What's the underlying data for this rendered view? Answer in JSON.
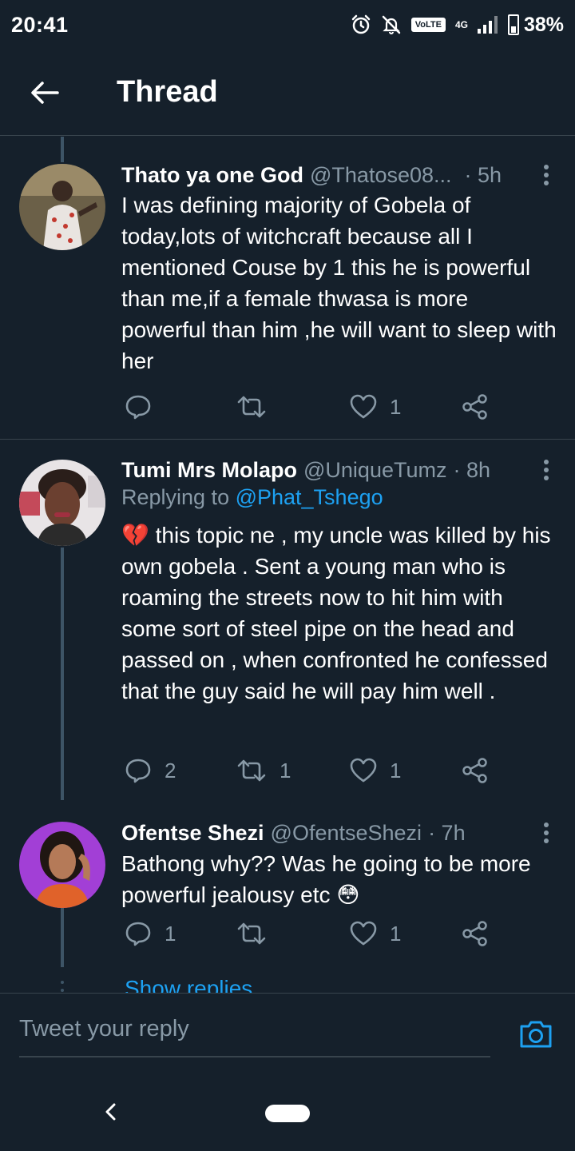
{
  "status_bar": {
    "time": "20:41",
    "volte": "VoLTE",
    "network": "4G",
    "battery": "38%"
  },
  "header": {
    "title": "Thread"
  },
  "tweets": [
    {
      "name": "Thato ya one God",
      "handle": "@Thatose08...",
      "time": "· 5h",
      "text": "I was defining majority of Gobela of today,lots of witchcraft because all I mentioned Couse by 1 this he is powerful than me,if a female thwasa is more powerful than him ,he will want to sleep with her",
      "replies": "",
      "retweets": "",
      "likes": "1"
    },
    {
      "name": "Tumi Mrs Molapo",
      "handle": "@UniqueTumz",
      "time": "· 8h",
      "replying_prefix": "Replying to ",
      "replying_to": "@Phat_Tshego",
      "emoji": "💔",
      "text": "this topic ne , my uncle was killed by his own gobela . Sent a young man who is roaming the streets now to hit him with some sort of steel pipe on the head and passed on , when confronted he confessed that the guy said he will pay him well .",
      "replies": "2",
      "retweets": "1",
      "likes": "1"
    },
    {
      "name": "Ofentse Shezi",
      "handle": "@OfentseShezi",
      "time": "· 7h",
      "text": "Bathong why?? Was he going to be more powerful jealousy etc",
      "emoji": "😳",
      "replies": "1",
      "retweets": "",
      "likes": "1"
    }
  ],
  "show_replies": "Show replies",
  "composer": {
    "placeholder": "Tweet your reply"
  },
  "colors": {
    "background": "#15202b",
    "accent": "#1da1f2",
    "secondary_text": "#8899a6",
    "divider": "#38444d"
  }
}
